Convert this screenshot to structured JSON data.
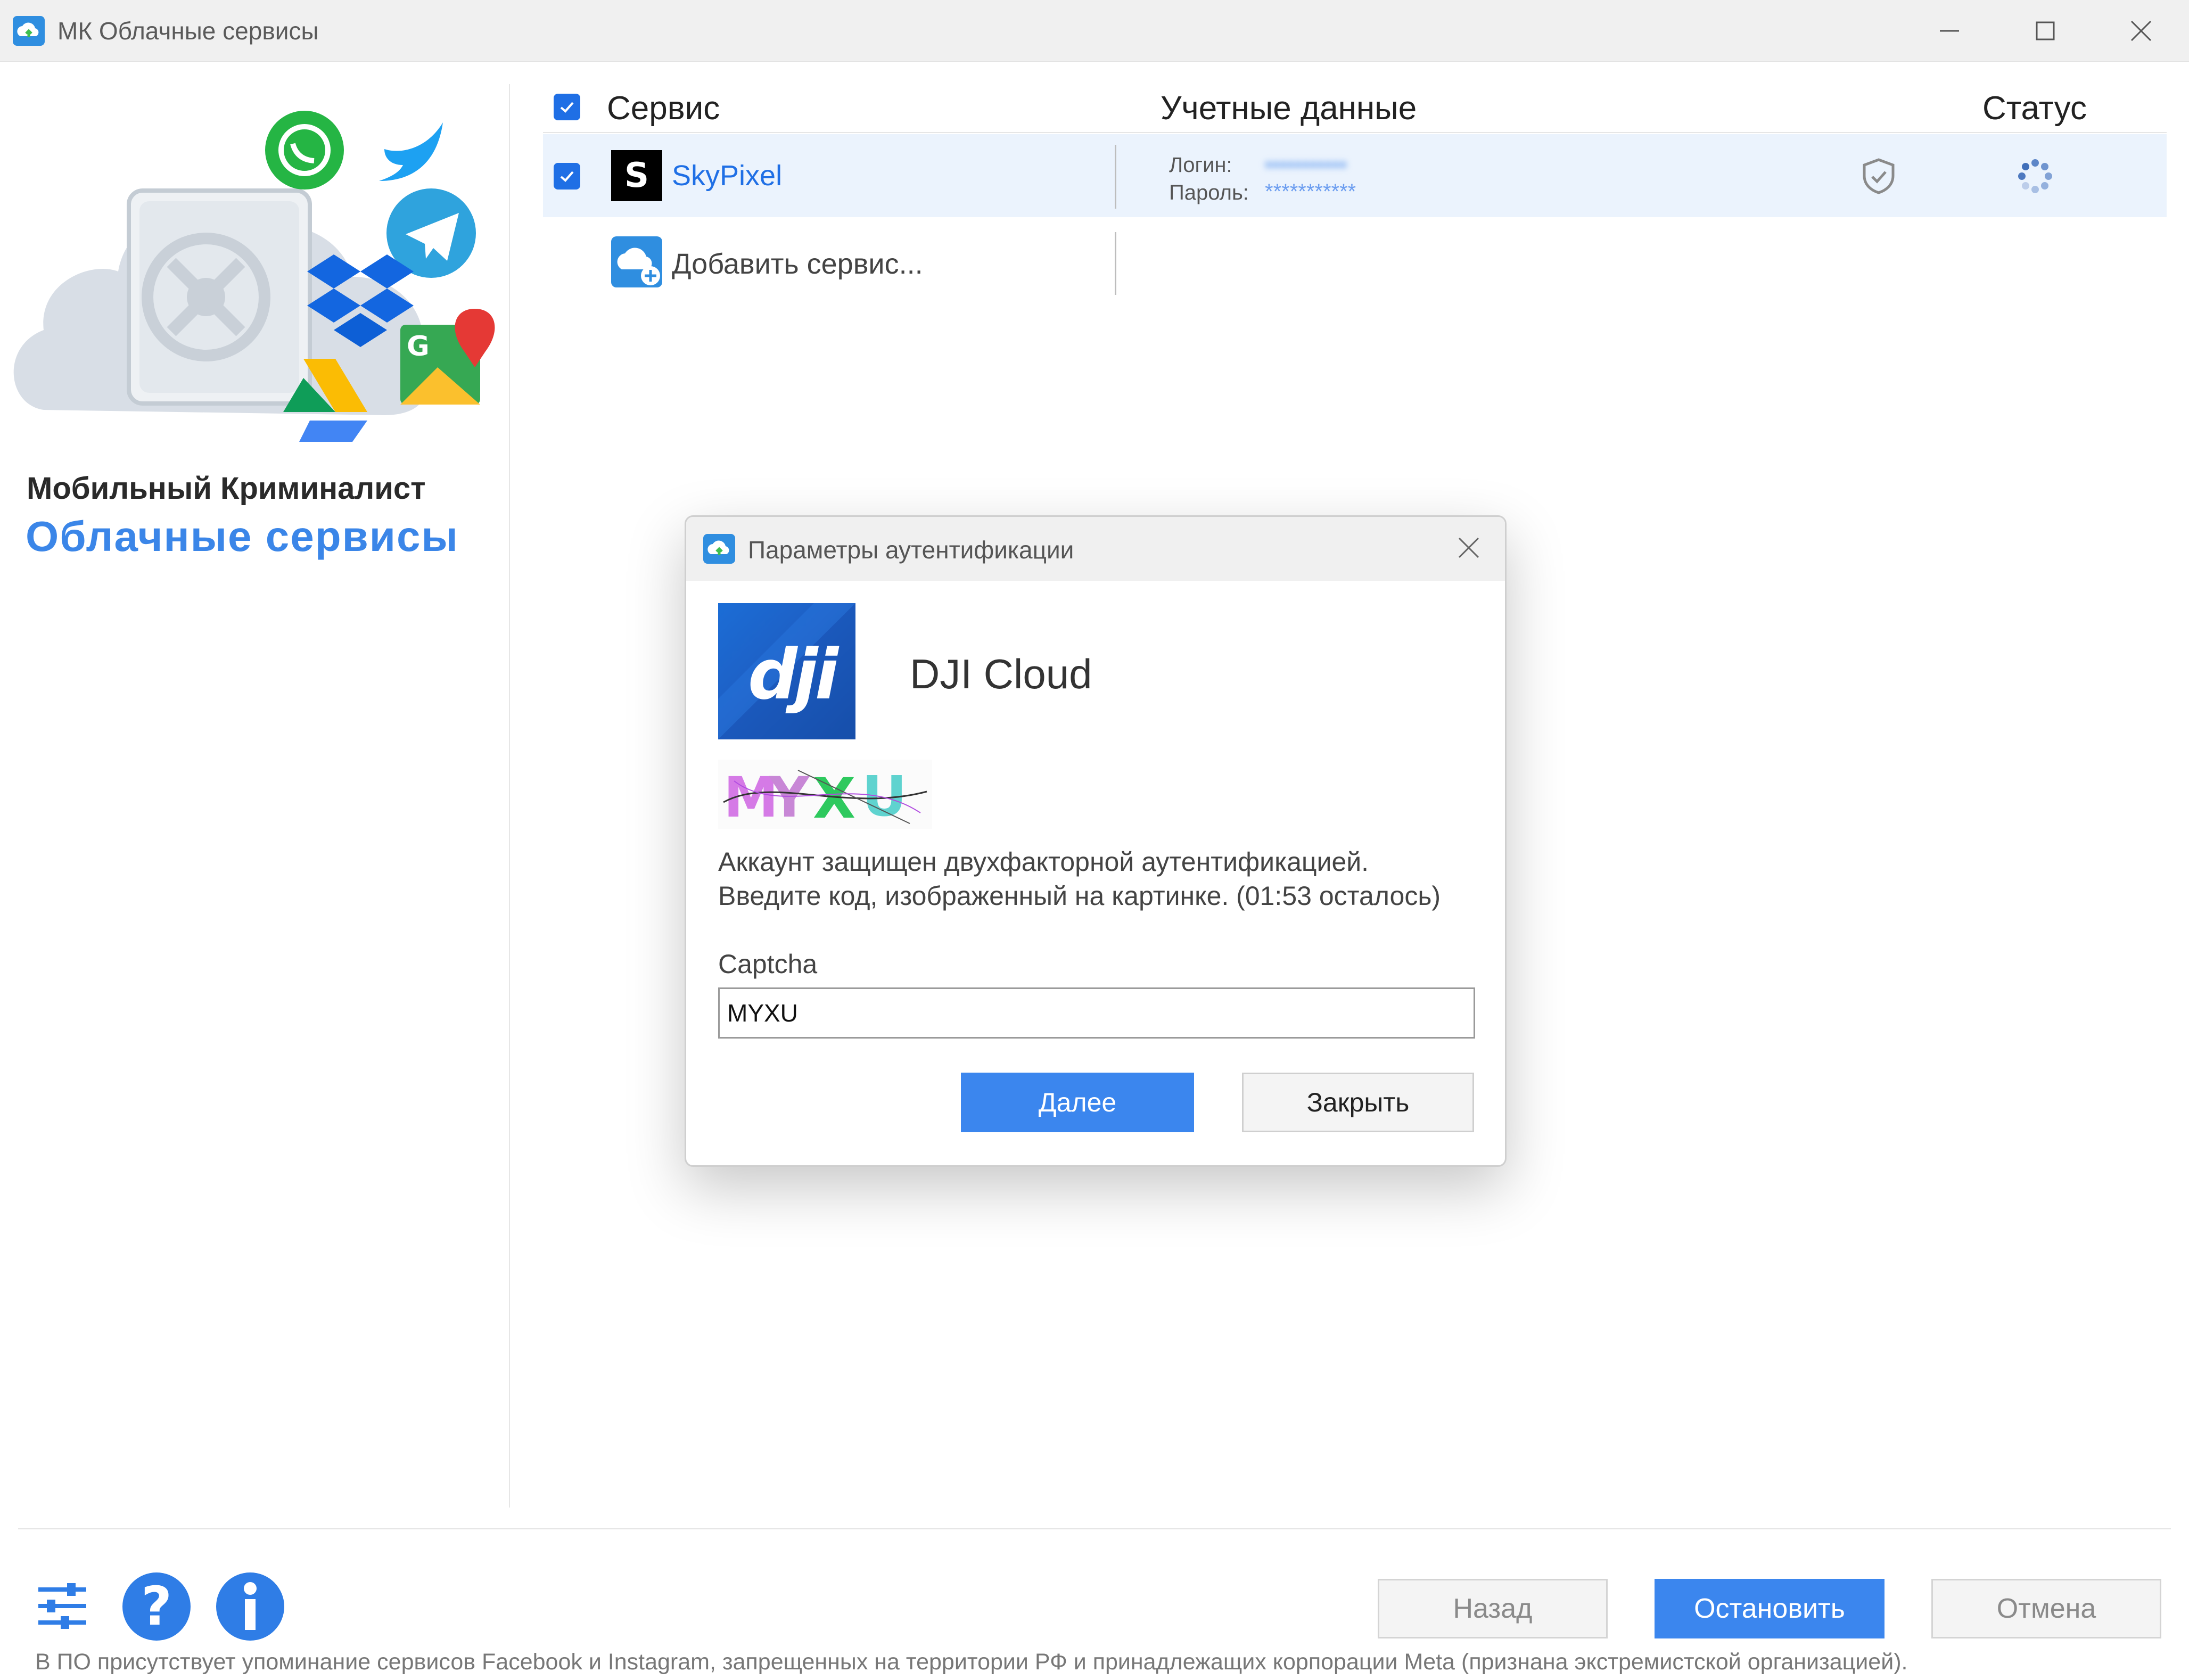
{
  "window": {
    "title": "МК Облачные сервисы"
  },
  "branding": {
    "line1": "Мобильный Криминалист",
    "line2": "Облачные сервисы"
  },
  "table": {
    "headers": {
      "service": "Сервис",
      "credentials": "Учетные данные",
      "status": "Статус"
    },
    "rows": [
      {
        "service": "SkyPixel",
        "logo_letter": "S",
        "login_label": "Логин:",
        "login_value": "•••••••••••",
        "password_label": "Пароль:",
        "password_value": "***********"
      }
    ],
    "add_service": "Добавить сервис..."
  },
  "dialog": {
    "title": "Параметры аутентификации",
    "service_name": "DJI Cloud",
    "logo_text": "dji",
    "captcha_text": "MYXU",
    "message_line1": "Аккаунт защищен двухфакторной аутентификацией.",
    "message_line2": "Введите код, изображенный на картинке. (01:53 осталось)",
    "field_label": "Captcha",
    "field_value": "MYXU",
    "next_label": "Далее",
    "close_label": "Закрыть"
  },
  "footer": {
    "back_label": "Назад",
    "stop_label": "Остановить",
    "cancel_label": "Отмена",
    "note": "В ПО присутствует упоминание сервисов Facebook и Instagram, запрещенных на территории РФ и принадлежащих корпорации Meta (признана экстремистской организацией)."
  },
  "colors": {
    "accent": "#3b86ee",
    "checkbox": "#1f6fe5",
    "selected_row": "#ebf3fd"
  }
}
